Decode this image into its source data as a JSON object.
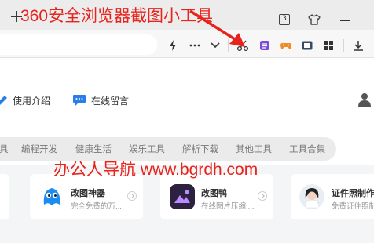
{
  "annotation": {
    "title": "360安全浏览器截图小工具",
    "site_mark": "办公人导航 www.bgrdh.com",
    "color": "#e8231c"
  },
  "browser": {
    "tab_count": "3",
    "toolbar_icons": [
      "flash-icon",
      "more-icon",
      "chevron-down-icon",
      "scissors-icon",
      "notes-icon",
      "game-icon",
      "reader-icon",
      "apps-grid-icon",
      "download-icon"
    ]
  },
  "page": {
    "nav": {
      "intro_label": "使用介绍",
      "message_label": "在线留言"
    },
    "categories": [
      "具",
      "编程开发",
      "健康生活",
      "娱乐工具",
      "解析下载",
      "其他工具",
      "工具合集"
    ],
    "cards": [
      {
        "name": "改图神器",
        "desc": "完全免费的万..."
      },
      {
        "name": "改图鸭",
        "desc": "在线图片压缩,..."
      },
      {
        "name": "证件照制作",
        "desc": "免费证件照制"
      }
    ],
    "colors": {
      "accent_blue": "#2b7de9",
      "purple": "#7b4bd8",
      "orange": "#f08a24"
    }
  }
}
